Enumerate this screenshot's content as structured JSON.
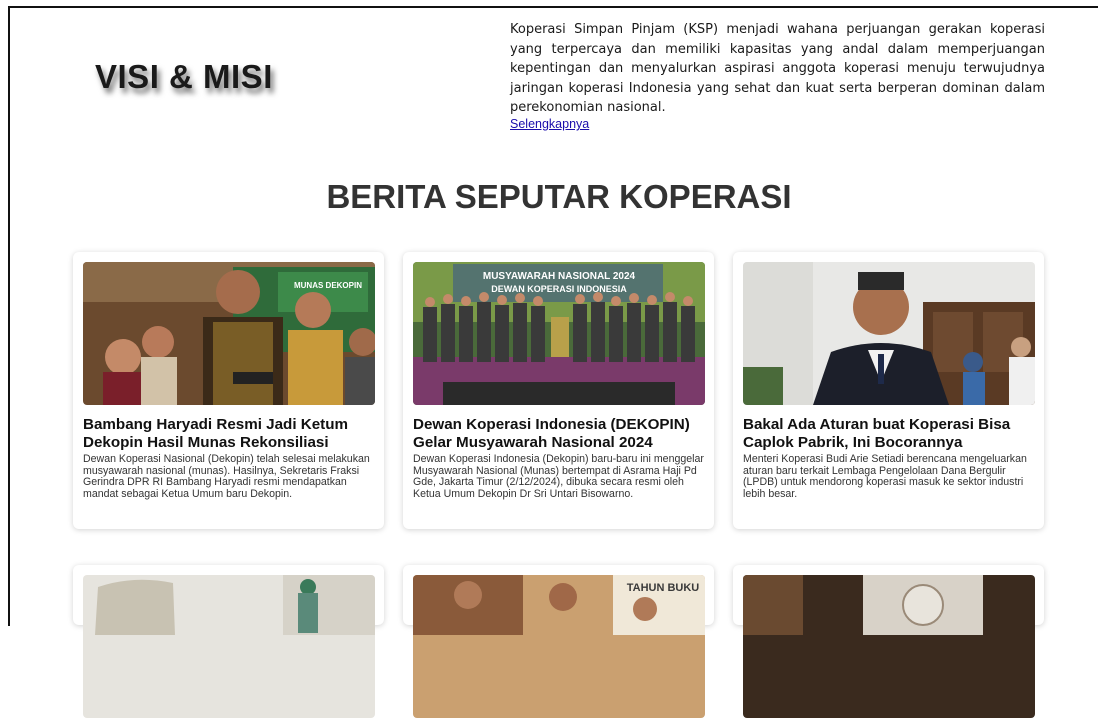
{
  "visi": {
    "title": "VISI & MISI",
    "text": "Koperasi Simpan Pinjam (KSP) menjadi wahana perjuangan gerakan koperasi yang terpercaya dan memiliki kapasitas yang andal dalam memperjuangan kepentingan dan menyalurkan aspirasi anggota koperasi menuju terwujudnya jaringan koperasi Indonesia yang sehat dan kuat serta berperan dominan dalam perekonomian nasional.",
    "link": "Selengkapnya"
  },
  "news": {
    "title": "BERITA SEPUTAR KOPERASI",
    "cards": [
      {
        "title": "Bambang Haryadi Resmi Jadi Ketum Dekopin Hasil Munas Rekonsiliasi",
        "desc": "Dewan Koperasi Nasional (Dekopin) telah selesai melakukan musyawarah nasional (munas). Hasilnya, Sekretaris Fraksi Gerindra DPR RI Bambang Haryadi resmi mendapatkan mandat sebagai Ketua Umum baru Dekopin.",
        "image_banner": "MUNAS DEKOPIN"
      },
      {
        "title": "Dewan Koperasi Indonesia (DEKOPIN) Gelar Musyawarah Nasional 2024",
        "desc": "Dewan Koperasi Indonesia (Dekopin) baru-baru ini menggelar Musyawarah Nasional (Munas) bertempat di Asrama Haji Pd Gde, Jakarta Timur (2/12/2024), dibuka secara resmi oleh Ketua Umum Dekopin Dr Sri Untari Bisowarno.",
        "image_banner": "MUSYAWARAH NASIONAL 2024",
        "image_banner2": "DEWAN KOPERASI INDONESIA"
      },
      {
        "title": "Bakal Ada Aturan buat Koperasi Bisa Caplok Pabrik, Ini Bocorannya",
        "desc": "Menteri Koperasi Budi Arie Setiadi berencana mengeluarkan aturan baru terkait Lembaga Pengelolaan Dana Bergulir (LPDB) untuk mendorong koperasi masuk ke sektor industri lebih besar."
      }
    ],
    "row2": [
      {
        "image_text": ""
      },
      {
        "image_text": "TAHUN BUKU"
      },
      {
        "image_text": ""
      }
    ]
  }
}
